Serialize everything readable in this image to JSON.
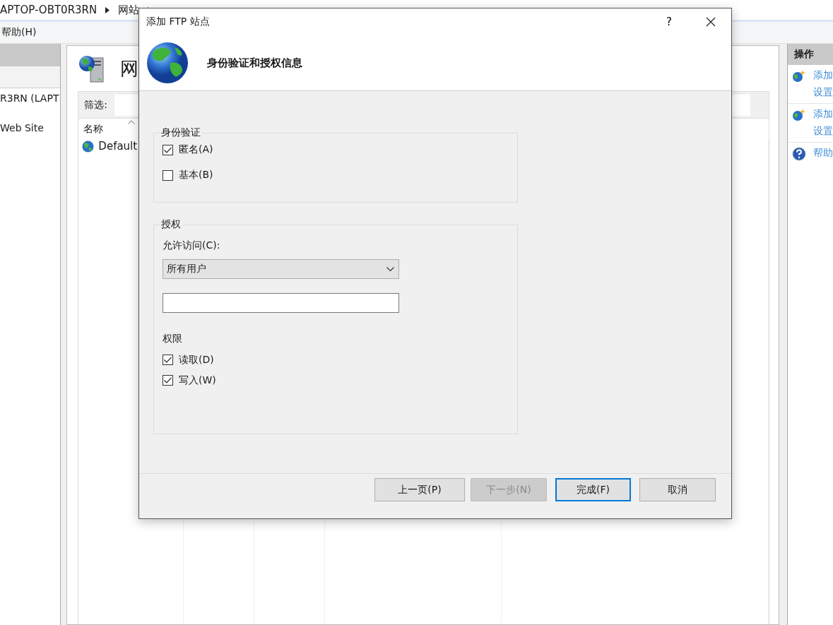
{
  "breadcrumb": [
    "APTOP-OBT0R3RN",
    "网站"
  ],
  "menu": [
    "帮助(H)"
  ],
  "left_pane": {
    "items": [
      {
        "label": "R3RN (LAPT",
        "selected": false
      },
      {
        "label": "Web Site",
        "selected": false
      }
    ]
  },
  "center": {
    "title": "网",
    "filter_label": "筛选:",
    "columns": [
      "名称"
    ],
    "rows": [
      {
        "name": "Default"
      }
    ]
  },
  "actions": {
    "title": "操作",
    "items": [
      {
        "kind": "add",
        "lines": [
          "添加",
          "设置"
        ]
      },
      {
        "kind": "add",
        "lines": [
          "添加",
          "设置"
        ]
      },
      {
        "kind": "help",
        "lines": [
          "帮助"
        ]
      }
    ]
  },
  "dialog": {
    "title": "添加 FTP 站点",
    "help": "?",
    "heading": "身份验证和授权信息",
    "authentication": {
      "title": "身份验证",
      "options": [
        {
          "label": "匿名(A)",
          "checked": true
        },
        {
          "label": "基本(B)",
          "checked": false
        }
      ]
    },
    "authorization": {
      "title": "授权",
      "access_label": "允许访问(C):",
      "access_value": "所有用户",
      "permissions_title": "权限",
      "permissions": [
        {
          "label": "读取(D)",
          "checked": true
        },
        {
          "label": "写入(W)",
          "checked": true
        }
      ]
    },
    "buttons": [
      {
        "label": "上一页(P)",
        "disabled": false,
        "default": false
      },
      {
        "label": "下一步(N)",
        "disabled": true,
        "default": false
      },
      {
        "label": "完成(F)",
        "disabled": false,
        "default": true
      },
      {
        "label": "取消",
        "disabled": false,
        "default": false
      }
    ]
  }
}
